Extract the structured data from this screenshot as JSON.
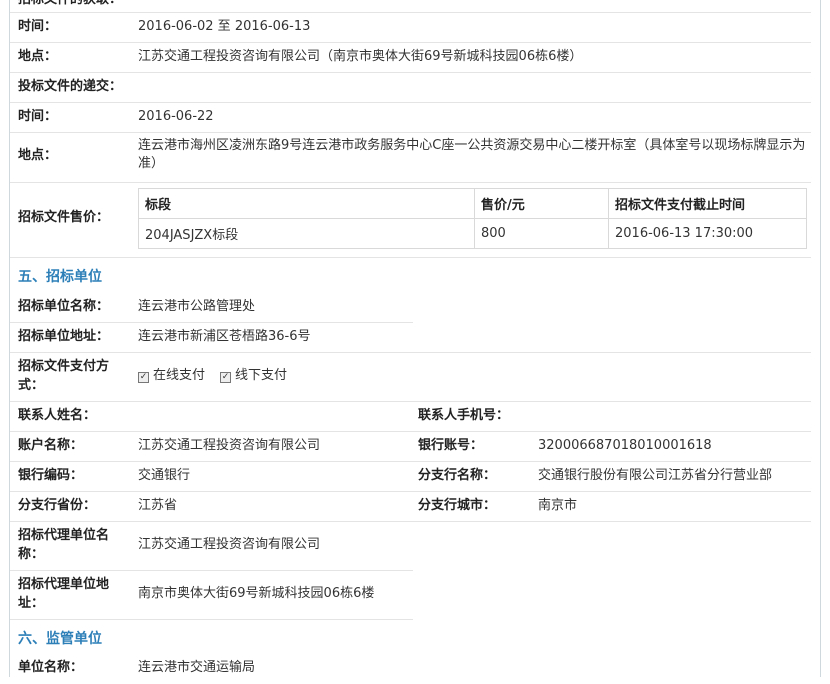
{
  "top_cut_label": "招标文件的获取：",
  "rows": {
    "time1_label": "时间：",
    "time1_value": "2016-06-02 至 2016-06-13",
    "place1_label": "地点：",
    "place1_value": "江苏交通工程投资咨询有限公司（南京市奥体大街69号新城科技园06栋6楼）",
    "submit_label": "投标文件的递交：",
    "time2_label": "时间：",
    "time2_value": "2016-06-22",
    "place2_label": "地点：",
    "place2_value_line1": "连云港市海州区凌洲东路9号连云港市政务服务中心C座一公共资源交易中心二楼开标室（具体室号以现场标牌显示为",
    "place2_value_line2": "准）",
    "price_label": "招标文件售价："
  },
  "price_table": {
    "headers": [
      "标段",
      "售价/元",
      "招标文件支付截止时间"
    ],
    "row": [
      "204JASJZX标段",
      "800",
      "2016-06-13 17:30:00"
    ]
  },
  "section5_title": "五、招标单位",
  "tenderer": {
    "name_label": "招标单位名称：",
    "name_value": "连云港市公路管理处",
    "addr_label": "招标单位地址：",
    "addr_value": "连云港市新浦区苍梧路36-6号",
    "pay_label_line1": "招标文件支付方",
    "pay_label_line2": "式：",
    "pay_online": "在线支付",
    "pay_offline": "线下支付",
    "contact_label": "联系人姓名：",
    "phone_label": "联系人手机号：",
    "account_label": "账户名称：",
    "account_value": "江苏交通工程投资咨询有限公司",
    "bankno_label": "银行账号：",
    "bankno_value": "320006687018010001618",
    "bankcode_label": "银行编码：",
    "bankcode_value": "交通银行",
    "branch_label": "分支行名称：",
    "branch_value": "交通银行股份有限公司江苏省分行营业部",
    "province_label": "分支行省份：",
    "province_value": "江苏省",
    "city_label": "分支行城市：",
    "city_value": "南京市",
    "agent_name_label_line1": "招标代理单位名",
    "agent_name_label_line2": "称：",
    "agent_name_value": "江苏交通工程投资咨询有限公司",
    "agent_addr_label_line1": "招标代理单位地",
    "agent_addr_label_line2": "址：",
    "agent_addr_value": "南京市奥体大街69号新城科技园06栋6楼"
  },
  "section6_title": "六、监管单位",
  "supervisor": {
    "name_label": "单位名称：",
    "name_value": "连云港市交通运输局"
  }
}
